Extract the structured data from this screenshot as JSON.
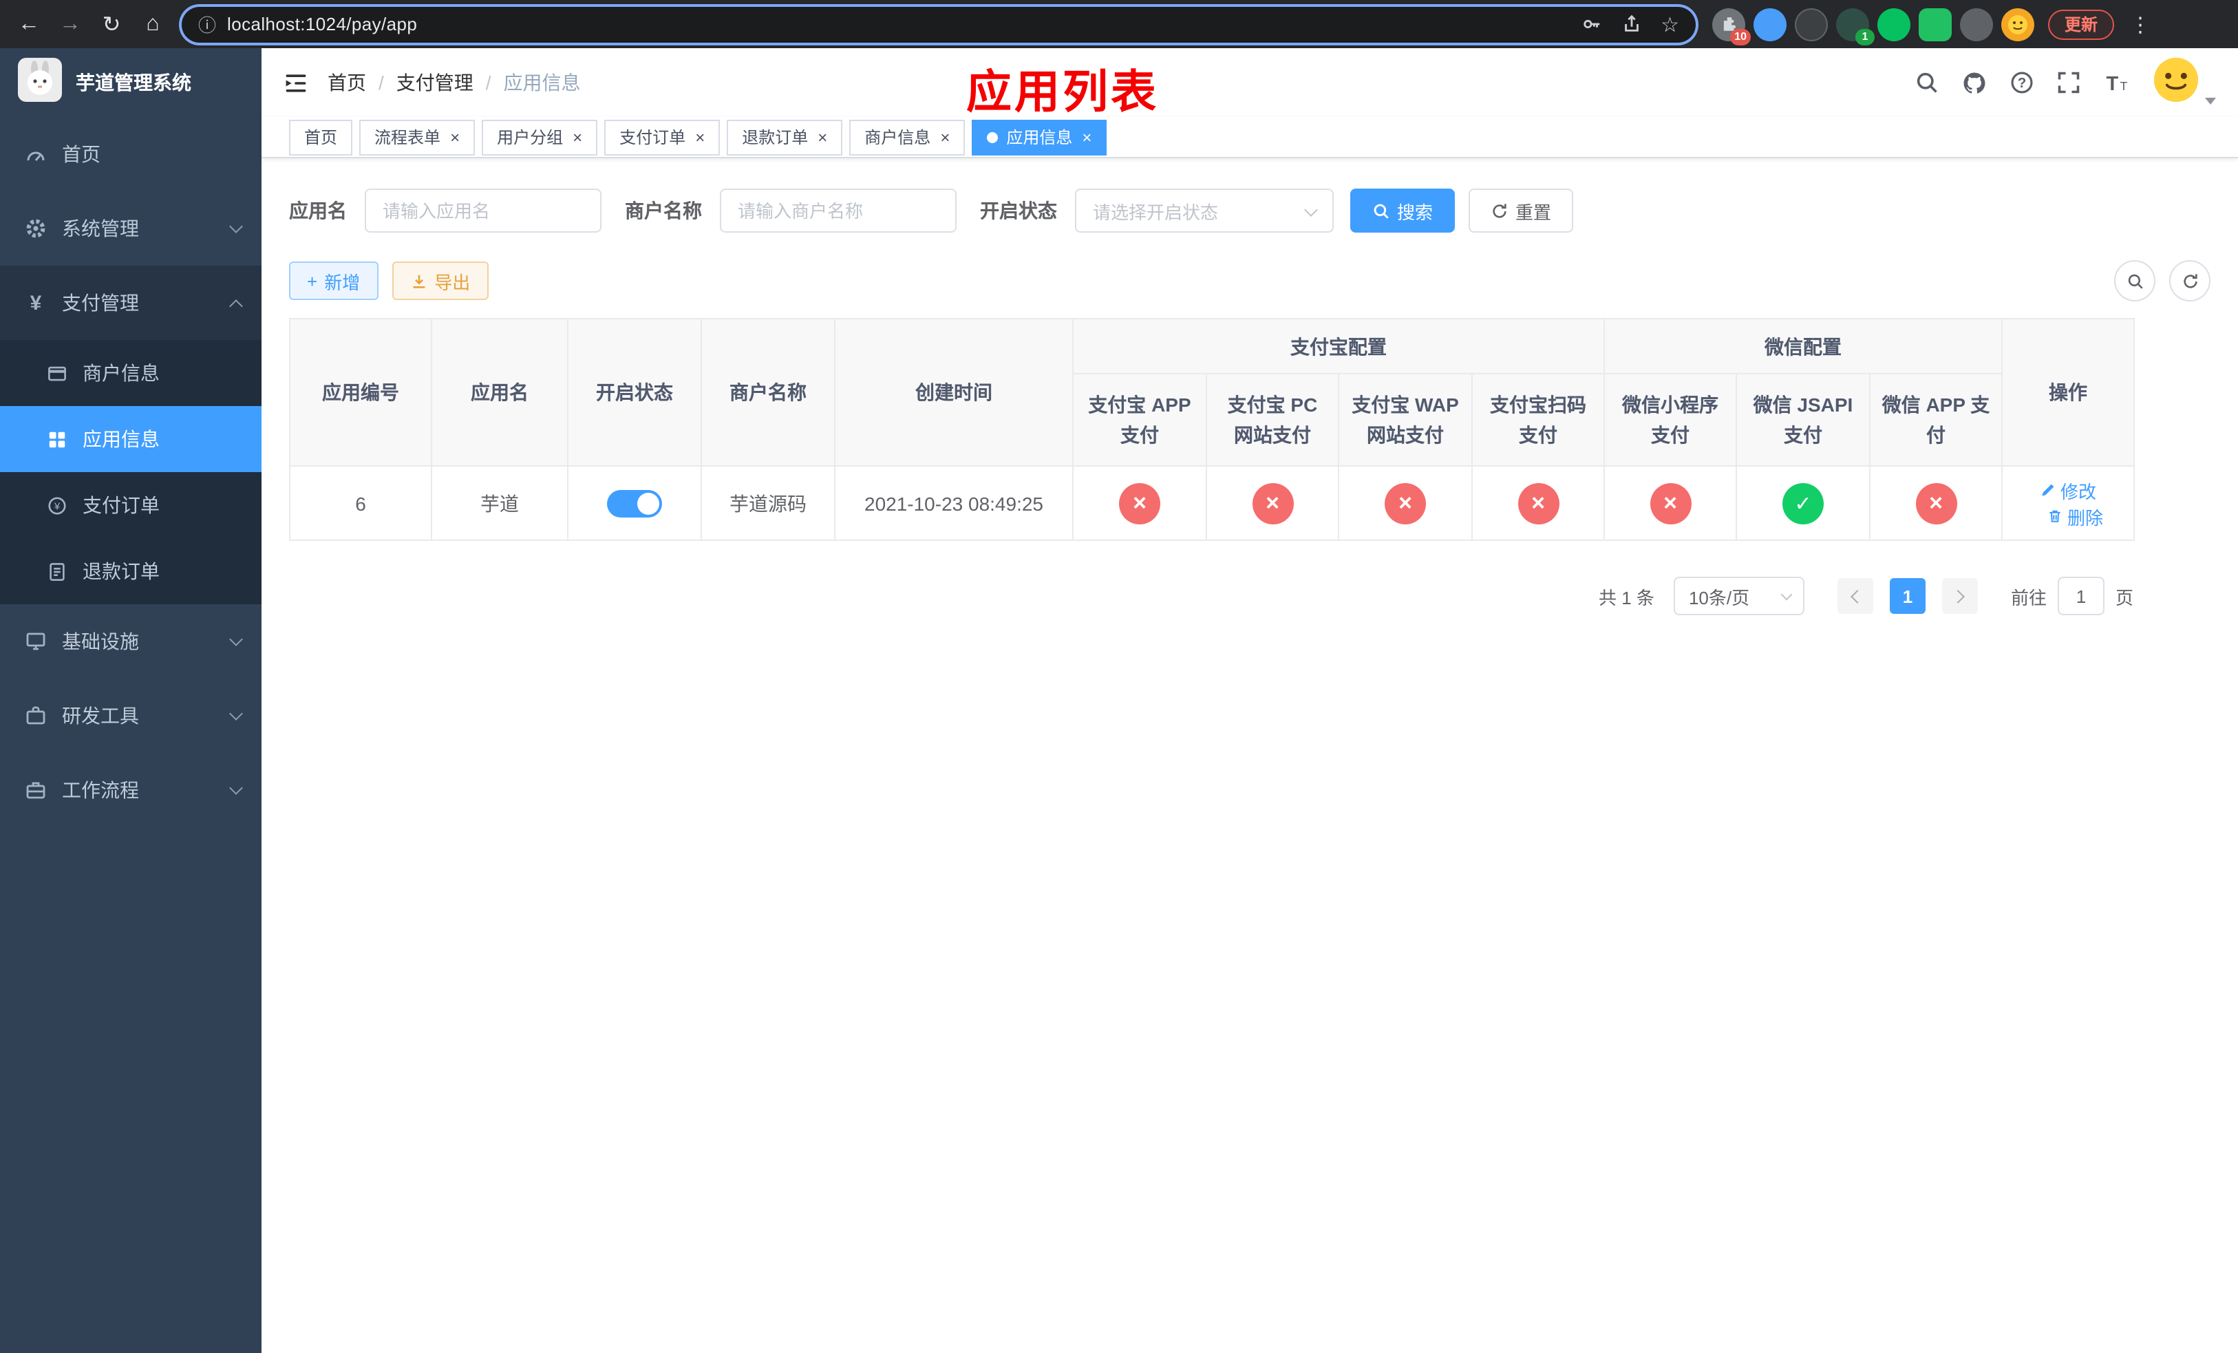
{
  "browser": {
    "url": "localhost:1024/pay/app",
    "update_label": "更新",
    "extension_badge_red": "10",
    "extension_badge_green": "1"
  },
  "glyphs": {
    "back": "←",
    "forward": "→",
    "reload": "↻",
    "home": "⌂",
    "info": "ⓘ",
    "star": "☆",
    "menu_dots": "⋮",
    "close": "×",
    "yen": "¥",
    "plus": "+"
  },
  "app": {
    "logo_title": "芋道管理系统"
  },
  "sidebar": {
    "items": [
      {
        "label": "首页"
      },
      {
        "label": "系统管理"
      },
      {
        "label": "支付管理"
      },
      {
        "label": "基础设施"
      },
      {
        "label": "研发工具"
      },
      {
        "label": "工作流程"
      }
    ],
    "payment_children": [
      {
        "label": "商户信息"
      },
      {
        "label": "应用信息"
      },
      {
        "label": "支付订单"
      },
      {
        "label": "退款订单"
      }
    ]
  },
  "breadcrumb": {
    "items": [
      "首页",
      "支付管理",
      "应用信息"
    ]
  },
  "annotation": {
    "text": "应用列表",
    "color": "#f40000"
  },
  "tabs": [
    {
      "label": "首页"
    },
    {
      "label": "流程表单"
    },
    {
      "label": "用户分组"
    },
    {
      "label": "支付订单"
    },
    {
      "label": "退款订单"
    },
    {
      "label": "商户信息"
    },
    {
      "label": "应用信息"
    }
  ],
  "filters": {
    "app_name": {
      "label": "应用名",
      "placeholder": "请输入应用名",
      "value": ""
    },
    "merchant_name": {
      "label": "商户名称",
      "placeholder": "请输入商户名称",
      "value": ""
    },
    "status": {
      "label": "开启状态",
      "placeholder": "请选择开启状态",
      "value": ""
    },
    "search_label": "搜索",
    "reset_label": "重置"
  },
  "toolbar": {
    "add_label": "新增",
    "export_label": "导出"
  },
  "table": {
    "columns": {
      "app_id": "应用编号",
      "app_name": "应用名",
      "status": "开启状态",
      "merchant": "商户名称",
      "created": "创建时间",
      "alipay_group": "支付宝配置",
      "wechat_group": "微信配置",
      "actions": "操作",
      "alipay_app": "支付宝 APP 支付",
      "alipay_pc": "支付宝 PC 网站支付",
      "alipay_wap": "支付宝 WAP 网站支付",
      "alipay_qr": "支付宝扫码支付",
      "wx_lite": "微信小程序支付",
      "wx_jsapi": "微信 JSAPI 支付",
      "wx_app": "微信 APP 支付"
    },
    "rows": [
      {
        "app_id": "6",
        "app_name": "芋道",
        "enabled": "true",
        "merchant": "芋道源码",
        "created": "2021-10-23 08:49:25",
        "configs": [
          "no",
          "no",
          "no",
          "no",
          "no",
          "yes",
          "no"
        ],
        "edit_label": "修改",
        "delete_label": "删除"
      }
    ]
  },
  "pagination": {
    "total": "共 1 条",
    "page_size": "10条/页",
    "current_page": "1",
    "goto_label": "前往",
    "goto_value": "1",
    "page_suffix": "页"
  },
  "colors": {
    "primary": "#409eff",
    "danger": "#f56c6c",
    "success": "#13ce66",
    "warning": "#e6a23c",
    "sidebar_bg": "#304156",
    "submenu_bg": "#1f2d3d"
  }
}
